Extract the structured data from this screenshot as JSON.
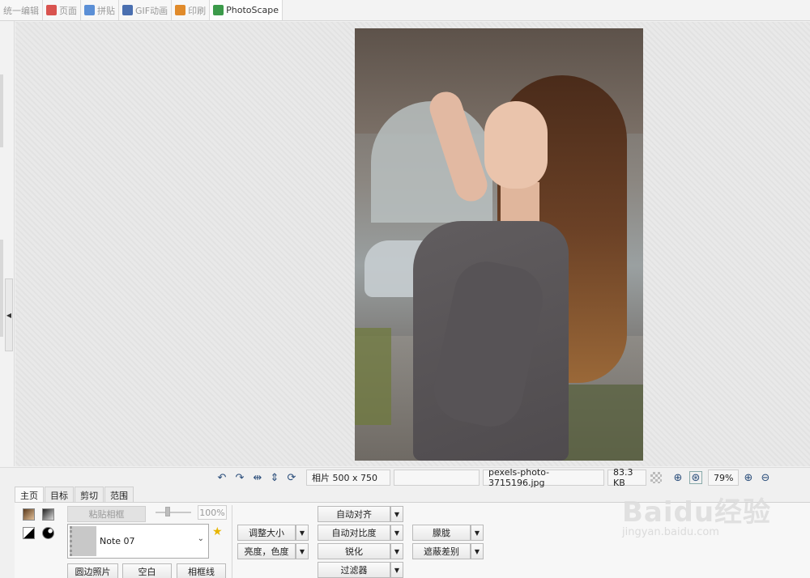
{
  "top_tabs": [
    {
      "label": "统一编辑",
      "icon": "",
      "color": ""
    },
    {
      "label": "页面",
      "icon": "page-icon",
      "color": "#d9534f"
    },
    {
      "label": "拼贴",
      "icon": "combine-icon",
      "color": "#5b8fd6"
    },
    {
      "label": "GIF动画",
      "icon": "gif-icon",
      "color": "#4a6fb0"
    },
    {
      "label": "印刷",
      "icon": "print-icon",
      "color": "#e08a2a"
    },
    {
      "label": "PhotoScape",
      "icon": "photoscape-icon",
      "color": "#3b9a4a"
    }
  ],
  "status": {
    "photo_size": "相片 500 x 750",
    "filename": "pexels-photo-3715196.jpg",
    "filesize": "83.3 KB",
    "zoom": "79%"
  },
  "panel_tabs": [
    "主页",
    "目标",
    "剪切",
    "范围"
  ],
  "tools": {
    "paste_frame": "粘贴相框",
    "opacity": "100%",
    "frame_name": "Note 07",
    "round_photo": "圆边照片",
    "blank": "空白",
    "frame_line": "相框线",
    "resize": "调整大小",
    "brightness": "亮度，色度",
    "auto_level": "自动对齐",
    "auto_contrast": "自动对比度",
    "sharpen": "锐化",
    "filter": "过滤器",
    "blur": "朦胧",
    "backlight": "遮蔽差别"
  },
  "watermark": {
    "logo": "Baidu经验",
    "url": "jingyan.baidu.com"
  }
}
